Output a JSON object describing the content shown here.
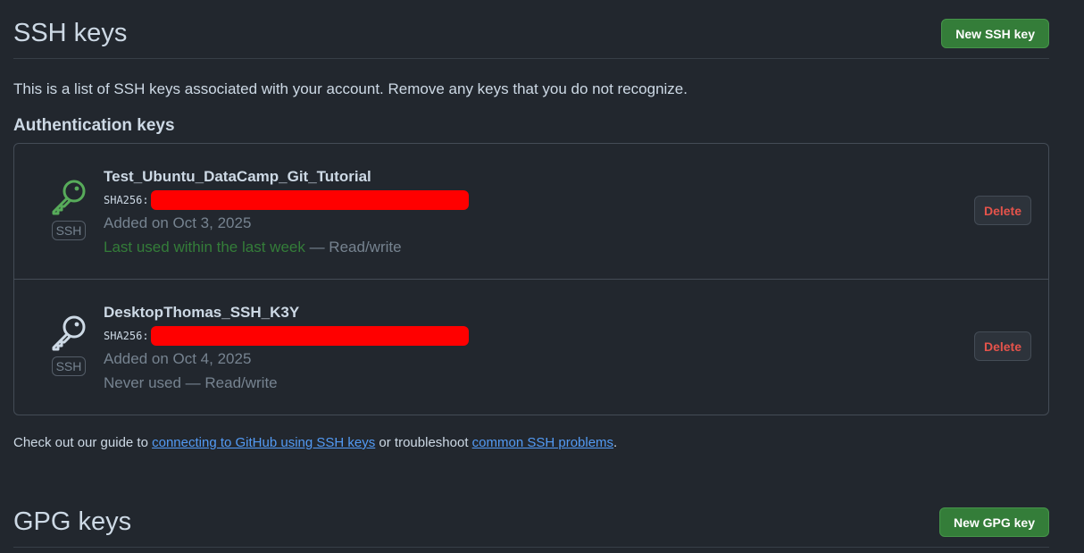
{
  "ssh_section": {
    "title": "SSH keys",
    "new_button": "New SSH key",
    "intro": "This is a list of SSH keys associated with your account. Remove any keys that you do not recognize.",
    "subheading": "Authentication keys"
  },
  "keys": [
    {
      "name": "Test_Ubuntu_DataCamp_Git_Tutorial",
      "fingerprint_label": "SHA256:",
      "added": "Added on Oct 3, 2025",
      "usage_highlight": "Last used within the last week",
      "usage_rest": " — Read/write",
      "badge": "SSH",
      "icon": "key-icon",
      "icon_color": "#57ab5a",
      "delete_label": "Delete"
    },
    {
      "name": "DesktopThomas_SSH_K3Y",
      "fingerprint_label": "SHA256:",
      "added": "Added on Oct 4, 2025",
      "usage_highlight": "",
      "usage_rest": "Never used — Read/write",
      "badge": "SSH",
      "icon": "key-icon",
      "icon_color": "#cdd9e5",
      "delete_label": "Delete"
    }
  ],
  "guide": {
    "prefix": "Check out our guide to ",
    "link1": "connecting to GitHub using SSH keys",
    "middle": " or troubleshoot ",
    "link2": "common SSH problems",
    "suffix": "."
  },
  "gpg_section": {
    "title": "GPG keys",
    "new_button": "New GPG key"
  },
  "colors": {
    "background": "#22272e",
    "primary_button": "#347d39",
    "danger_text": "#e5534b",
    "link": "#539bf5",
    "redaction": "#ff0000"
  }
}
